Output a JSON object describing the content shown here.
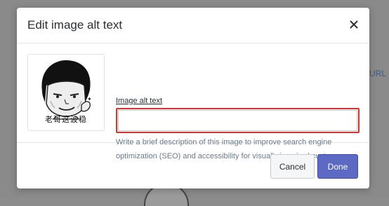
{
  "background": {
    "link_text": "n URL"
  },
  "modal": {
    "title": "Edit image alt text",
    "close_label": "×",
    "image": {
      "caption": "老哥这波稳"
    },
    "field": {
      "label": "Image alt text",
      "value": "",
      "placeholder": "",
      "help": "Write a brief description of this image to improve search engine optimization (SEO) and accessibility for visually impaired customers."
    },
    "footer": {
      "cancel_label": "Cancel",
      "done_label": "Done"
    }
  },
  "colors": {
    "accent": "#5c6ac4",
    "error_border": "#d9342b",
    "help_text": "#6b7b89"
  }
}
